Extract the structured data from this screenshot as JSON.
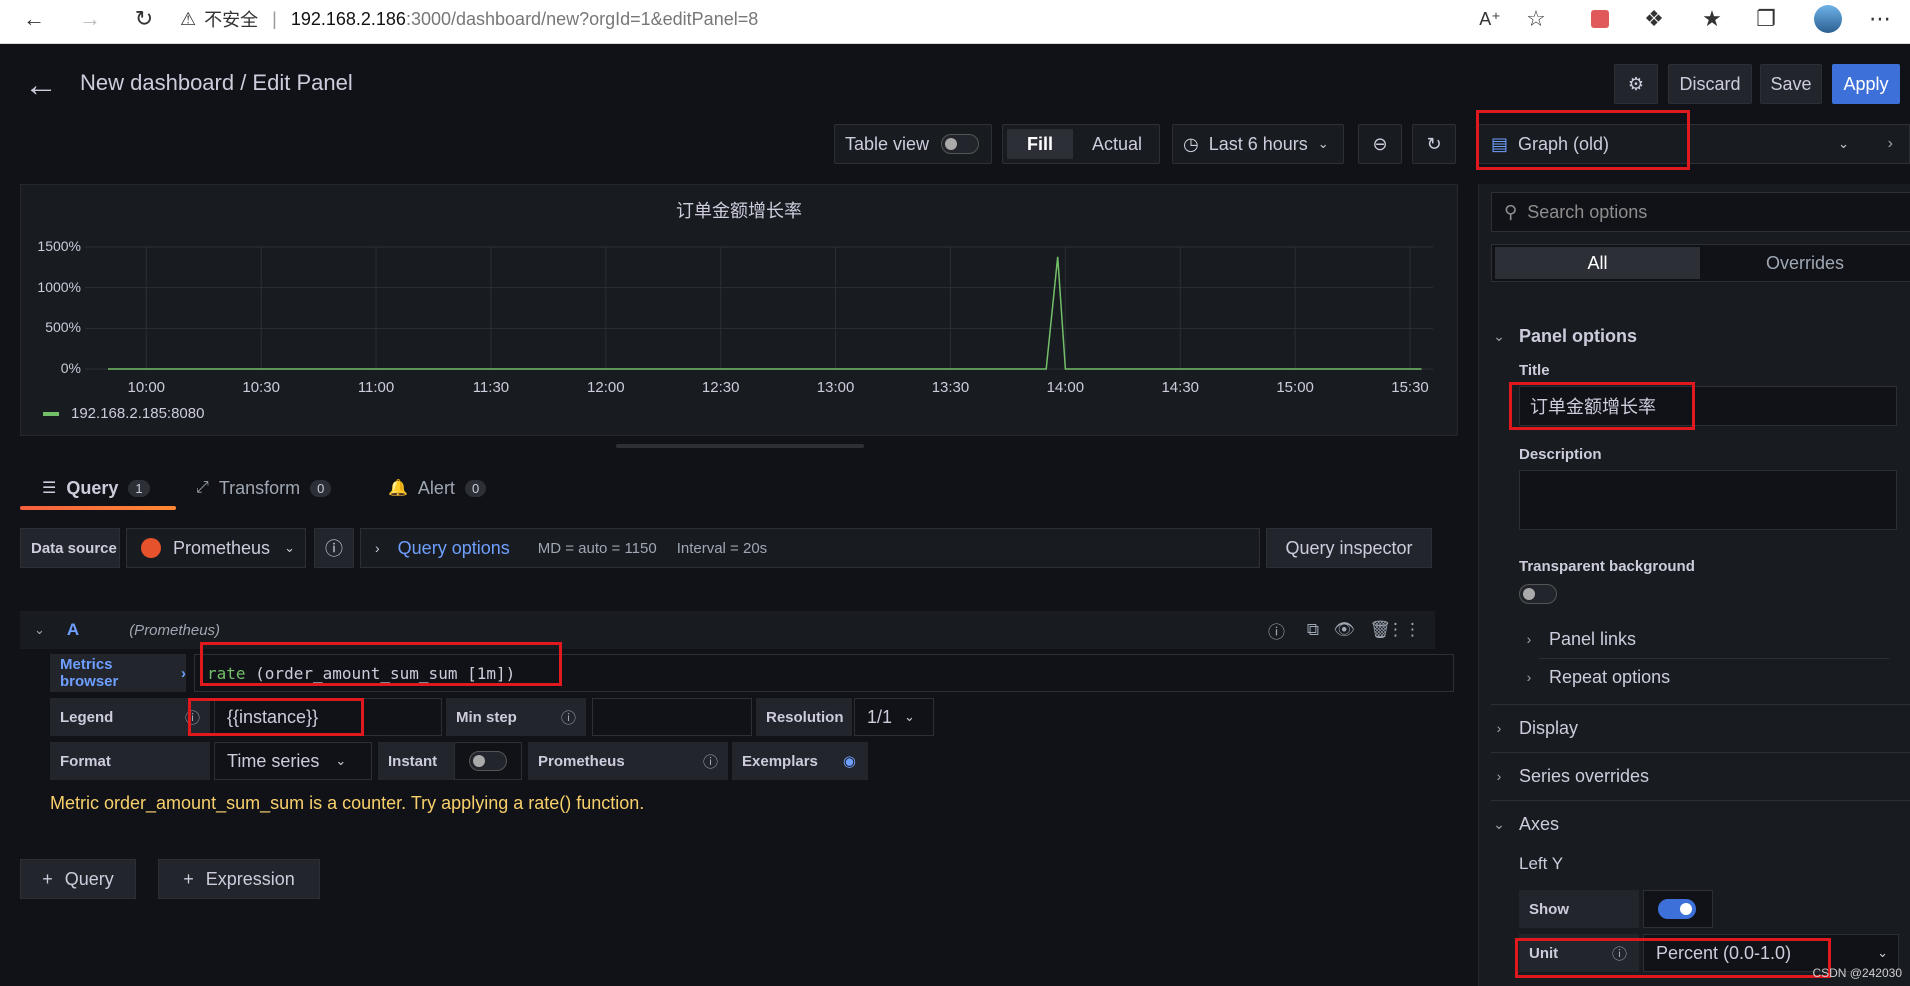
{
  "browser": {
    "insecure_label": "不安全",
    "url_host": "192.168.2.186",
    "url_path": ":3000/dashboard/new?orgId=1&editPanel=8"
  },
  "header": {
    "title": "New dashboard / Edit Panel",
    "discard": "Discard",
    "save": "Save",
    "apply": "Apply"
  },
  "toolbar": {
    "table_view": "Table view",
    "fill": "Fill",
    "actual": "Actual",
    "time_range": "Last 6 hours"
  },
  "chart_data": {
    "type": "line",
    "title": "订单金额增长率",
    "x": [
      "09:50",
      "10:00",
      "10:30",
      "11:00",
      "11:30",
      "12:00",
      "12:30",
      "13:00",
      "13:30",
      "13:50",
      "13:55",
      "13:58",
      "14:00",
      "14:30",
      "15:00",
      "15:30",
      "15:33"
    ],
    "series": [
      {
        "name": "192.168.2.185:8080",
        "values": [
          0,
          0,
          0,
          0,
          0,
          0,
          0,
          0,
          0,
          0,
          0,
          1380,
          0,
          0,
          0,
          0,
          0
        ],
        "color": "#73bf69"
      }
    ],
    "y_ticks": [
      "1500%",
      "1000%",
      "500%",
      "0%"
    ],
    "x_ticks": [
      "10:00",
      "10:30",
      "11:00",
      "11:30",
      "12:00",
      "12:30",
      "13:00",
      "13:30",
      "14:00",
      "14:30",
      "15:00",
      "15:30"
    ],
    "ylim": [
      0,
      1500
    ],
    "unit": "%",
    "grid": true,
    "legend_placement": "bottom-left"
  },
  "tabs": [
    {
      "label": "Query",
      "count": "1"
    },
    {
      "label": "Transform",
      "count": "0"
    },
    {
      "label": "Alert",
      "count": "0"
    }
  ],
  "query": {
    "datasource_label": "Data source",
    "datasource": "Prometheus",
    "query_options": "Query options",
    "md_info": "MD = auto = 1150",
    "interval_info": "Interval = 20s",
    "inspector": "Query inspector",
    "ref_id": "A",
    "ref_source": "(Prometheus)",
    "metrics_browser": "Metrics browser",
    "expr_fn": "rate",
    "expr_rest": " (order_amount_sum_sum [1m])",
    "legend_label": "Legend",
    "legend_value": "{{instance}}",
    "min_step_label": "Min step",
    "resolution_label": "Resolution",
    "resolution_value": "1/1",
    "format_label": "Format",
    "format_value": "Time series",
    "instant_label": "Instant",
    "prometheus_label": "Prometheus",
    "exemplars_label": "Exemplars",
    "warning": "Metric order_amount_sum_sum is a counter. Try applying a rate() function.",
    "add_query": "Query",
    "add_expression": "Expression"
  },
  "options": {
    "viz_name": "Graph (old)",
    "search_placeholder": "Search options",
    "tab_all": "All",
    "tab_overrides": "Overrides",
    "panel_options": "Panel options",
    "title_label": "Title",
    "title_value": "订单金额增长率",
    "description_label": "Description",
    "transparent_label": "Transparent background",
    "panel_links": "Panel links",
    "repeat_options": "Repeat options",
    "display": "Display",
    "series_overrides": "Series overrides",
    "axes": "Axes",
    "left_y": "Left Y",
    "show_label": "Show",
    "unit_label": "Unit",
    "unit_value": "Percent (0.0-1.0)"
  },
  "watermark": "CSDN @242030"
}
